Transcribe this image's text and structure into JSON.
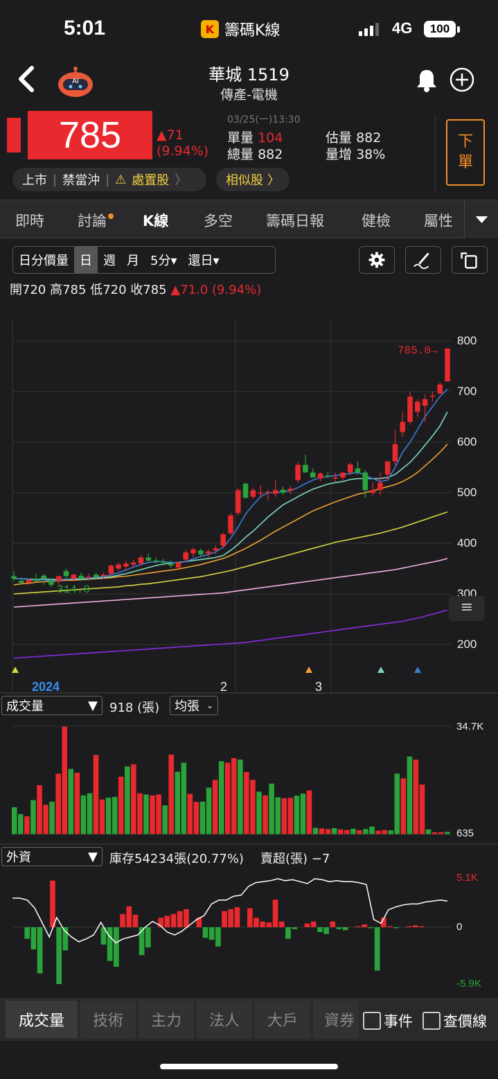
{
  "status_bar": {
    "time": "5:01",
    "app_name": "籌碼K線",
    "network": "4G",
    "battery": "100"
  },
  "header": {
    "stock_name": "華城 1519",
    "category": "傳產-電機"
  },
  "quote": {
    "price": "785",
    "change": "▲71",
    "change_pct": "(9.94%)",
    "datetime": "03/25(一)13:30",
    "unit_volume_label": "單量",
    "unit_volume": "104",
    "total_volume_label": "總量",
    "total_volume": "882",
    "est_volume_label": "估量",
    "est_volume": "882",
    "vol_increase_label": "量增",
    "vol_increase": "38%",
    "sell_button": [
      "下",
      "單"
    ]
  },
  "tags": {
    "market": "上市",
    "day_trade": "禁當沖",
    "disposition": "處置股",
    "similar": "相似股"
  },
  "tabs": [
    {
      "label": "即時"
    },
    {
      "label": "討論"
    },
    {
      "label": "K線"
    },
    {
      "label": "多空"
    },
    {
      "label": "籌碼日報"
    },
    {
      "label": "健檢"
    },
    {
      "label": "屬性"
    }
  ],
  "period": {
    "options": [
      "日分價量",
      "日",
      "週",
      "月",
      "5分▾",
      "還日▾"
    ],
    "selected": "日"
  },
  "ohlc": {
    "open_label": "開",
    "open": "720",
    "high_label": "高",
    "high": "785",
    "low_label": "低",
    "low": "720",
    "close_label": "收",
    "close": "785",
    "change": "▲71.0 (9.94%)"
  },
  "kchart": {
    "y_ticks": [
      "800",
      "700",
      "600",
      "500",
      "400",
      "300",
      "200"
    ],
    "x_labels": [
      "2024",
      "2",
      "3"
    ],
    "last_label": "785.0→",
    "low_label": "314.0",
    "colors": {
      "up": "#e8292e",
      "down": "#2aa33a",
      "ma5": "#3a7bd5",
      "ma10": "#7fd8c0",
      "ma20": "#f0a030",
      "ma60": "#d8d840",
      "ma120": "#f0b0e0",
      "ma240": "#8a2be2"
    }
  },
  "volume_panel": {
    "selector": "成交量",
    "value": "918 (張)",
    "avg_button": "均張",
    "y_max": "34.7K",
    "y_min": "635"
  },
  "foreign_panel": {
    "selector": "外資",
    "inventory": "庫存54234張(20.77%)",
    "net": "賣超(張) −7",
    "y_max": "5.1K",
    "y_zero": "0",
    "y_min": "-5.9K"
  },
  "chart_data": [
    {
      "type": "candlestick",
      "title": "",
      "ylim": [
        200,
        800
      ],
      "candles": [
        {
          "o": 335,
          "h": 345,
          "l": 325,
          "c": 330
        },
        {
          "o": 326,
          "h": 332,
          "l": 320,
          "c": 322
        },
        {
          "o": 322,
          "h": 330,
          "l": 318,
          "c": 328
        },
        {
          "o": 330,
          "h": 340,
          "l": 325,
          "c": 325
        },
        {
          "o": 336,
          "h": 340,
          "l": 318,
          "c": 330
        },
        {
          "o": 326,
          "h": 330,
          "l": 314,
          "c": 318
        },
        {
          "o": 326,
          "h": 335,
          "l": 318,
          "c": 335
        },
        {
          "o": 345,
          "h": 350,
          "l": 330,
          "c": 335
        },
        {
          "o": 330,
          "h": 340,
          "l": 325,
          "c": 338
        },
        {
          "o": 336,
          "h": 342,
          "l": 326,
          "c": 330
        },
        {
          "o": 332,
          "h": 340,
          "l": 326,
          "c": 334
        },
        {
          "o": 338,
          "h": 342,
          "l": 330,
          "c": 333
        },
        {
          "o": 335,
          "h": 342,
          "l": 330,
          "c": 338
        },
        {
          "o": 340,
          "h": 358,
          "l": 336,
          "c": 356
        },
        {
          "o": 350,
          "h": 362,
          "l": 346,
          "c": 358
        },
        {
          "o": 354,
          "h": 366,
          "l": 348,
          "c": 360
        },
        {
          "o": 358,
          "h": 368,
          "l": 352,
          "c": 362
        },
        {
          "o": 360,
          "h": 376,
          "l": 356,
          "c": 372
        },
        {
          "o": 372,
          "h": 380,
          "l": 362,
          "c": 366
        },
        {
          "o": 366,
          "h": 372,
          "l": 360,
          "c": 364
        },
        {
          "o": 364,
          "h": 370,
          "l": 356,
          "c": 362
        },
        {
          "o": 360,
          "h": 366,
          "l": 352,
          "c": 356
        },
        {
          "o": 352,
          "h": 364,
          "l": 348,
          "c": 362
        },
        {
          "o": 368,
          "h": 386,
          "l": 362,
          "c": 382
        },
        {
          "o": 380,
          "h": 392,
          "l": 372,
          "c": 388
        },
        {
          "o": 386,
          "h": 390,
          "l": 374,
          "c": 378
        },
        {
          "o": 380,
          "h": 388,
          "l": 372,
          "c": 384
        },
        {
          "o": 386,
          "h": 396,
          "l": 378,
          "c": 390
        },
        {
          "o": 395,
          "h": 420,
          "l": 390,
          "c": 418
        },
        {
          "o": 420,
          "h": 460,
          "l": 416,
          "c": 455
        },
        {
          "o": 460,
          "h": 510,
          "l": 455,
          "c": 505
        },
        {
          "o": 518,
          "h": 520,
          "l": 488,
          "c": 490
        },
        {
          "o": 492,
          "h": 510,
          "l": 488,
          "c": 505
        },
        {
          "o": 500,
          "h": 515,
          "l": 492,
          "c": 500
        },
        {
          "o": 500,
          "h": 505,
          "l": 485,
          "c": 502
        },
        {
          "o": 498,
          "h": 525,
          "l": 492,
          "c": 505
        },
        {
          "o": 506,
          "h": 512,
          "l": 496,
          "c": 500
        },
        {
          "o": 504,
          "h": 514,
          "l": 498,
          "c": 508
        },
        {
          "o": 525,
          "h": 560,
          "l": 520,
          "c": 555
        },
        {
          "o": 555,
          "h": 575,
          "l": 540,
          "c": 540
        },
        {
          "o": 540,
          "h": 548,
          "l": 530,
          "c": 530
        },
        {
          "o": 528,
          "h": 540,
          "l": 522,
          "c": 538
        },
        {
          "o": 534,
          "h": 542,
          "l": 528,
          "c": 532
        },
        {
          "o": 528,
          "h": 540,
          "l": 522,
          "c": 530
        },
        {
          "o": 530,
          "h": 540,
          "l": 524,
          "c": 540
        },
        {
          "o": 540,
          "h": 560,
          "l": 535,
          "c": 556
        },
        {
          "o": 548,
          "h": 562,
          "l": 536,
          "c": 540
        },
        {
          "o": 540,
          "h": 545,
          "l": 490,
          "c": 505
        },
        {
          "o": 500,
          "h": 520,
          "l": 495,
          "c": 505
        },
        {
          "o": 505,
          "h": 540,
          "l": 495,
          "c": 520
        },
        {
          "o": 536,
          "h": 562,
          "l": 525,
          "c": 562
        },
        {
          "o": 562,
          "h": 624,
          "l": 555,
          "c": 596
        },
        {
          "o": 620,
          "h": 660,
          "l": 610,
          "c": 640
        },
        {
          "o": 640,
          "h": 700,
          "l": 635,
          "c": 690
        },
        {
          "o": 660,
          "h": 685,
          "l": 650,
          "c": 680
        },
        {
          "o": 672,
          "h": 695,
          "l": 640,
          "c": 685
        },
        {
          "o": 690,
          "h": 700,
          "l": 680,
          "c": 692
        },
        {
          "o": 696,
          "h": 718,
          "l": 695,
          "c": 714
        },
        {
          "o": 720,
          "h": 785,
          "l": 720,
          "c": 785
        }
      ],
      "ma5": [
        330,
        330,
        328,
        327,
        328,
        326,
        327,
        329,
        330,
        331,
        331,
        333,
        334,
        338,
        342,
        347,
        353,
        358,
        362,
        364,
        364,
        362,
        361,
        364,
        369,
        374,
        378,
        383,
        392,
        410,
        432,
        458,
        476,
        492,
        500,
        500,
        502,
        504,
        510,
        518,
        525,
        530,
        532,
        534,
        536,
        538,
        540,
        535,
        528,
        522,
        525,
        550,
        580,
        600,
        625,
        650,
        670,
        690,
        705
      ],
      "ma10": [
        330,
        330,
        329,
        329,
        329,
        329,
        328,
        329,
        329,
        329,
        330,
        331,
        332,
        334,
        337,
        340,
        344,
        348,
        352,
        356,
        359,
        361,
        362,
        364,
        366,
        368,
        370,
        372,
        376,
        386,
        398,
        412,
        424,
        438,
        452,
        464,
        476,
        484,
        492,
        500,
        507,
        512,
        517,
        520,
        522,
        526,
        528,
        528,
        528,
        528,
        530,
        536,
        548,
        560,
        576,
        594,
        612,
        632,
        660
      ],
      "ma20": [
        318,
        320,
        321,
        323,
        324,
        325,
        326,
        327,
        327,
        328,
        329,
        330,
        331,
        332,
        334,
        335,
        337,
        339,
        341,
        343,
        345,
        347,
        349,
        352,
        355,
        358,
        362,
        366,
        370,
        376,
        383,
        390,
        398,
        406,
        415,
        424,
        432,
        440,
        448,
        456,
        464,
        470,
        476,
        482,
        487,
        492,
        497,
        500,
        504,
        508,
        512,
        516,
        522,
        530,
        540,
        553,
        566,
        580,
        596
      ],
      "ma60": [
        300,
        301,
        302,
        303,
        304,
        305,
        306,
        307,
        308,
        309,
        310,
        311,
        312,
        313,
        314,
        316,
        317,
        319,
        320,
        322,
        324,
        326,
        328,
        330,
        332,
        334,
        337,
        340,
        343,
        346,
        350,
        354,
        358,
        362,
        366,
        370,
        374,
        378,
        382,
        386,
        390,
        394,
        398,
        402,
        405,
        408,
        411,
        414,
        417,
        420,
        424,
        428,
        432,
        437,
        442,
        447,
        452,
        457,
        462
      ],
      "ma120": [
        274,
        275,
        276,
        277,
        278,
        279,
        280,
        281,
        282,
        283,
        284,
        285,
        286,
        287,
        288,
        289,
        290,
        291,
        292,
        293,
        294,
        295,
        296,
        297,
        298,
        299,
        300,
        301,
        302,
        304,
        306,
        308,
        310,
        312,
        314,
        316,
        318,
        320,
        322,
        324,
        326,
        328,
        330,
        332,
        334,
        336,
        338,
        340,
        342,
        344,
        346,
        348,
        351,
        354,
        357,
        360,
        363,
        366,
        370
      ],
      "ma240": [
        173,
        174,
        175,
        176,
        177,
        178,
        179,
        180,
        181,
        182,
        183,
        184,
        185,
        186,
        187,
        188,
        189,
        190,
        191,
        192,
        193,
        194,
        195,
        196,
        197,
        198,
        199,
        200,
        201,
        202,
        203,
        204,
        206,
        208,
        210,
        212,
        214,
        216,
        218,
        220,
        222,
        224,
        226,
        228,
        230,
        232,
        234,
        236,
        238,
        240,
        242,
        244,
        246,
        249,
        252,
        256,
        260,
        264,
        268
      ]
    },
    {
      "type": "bar",
      "title": "成交量",
      "ylim": [
        635,
        34700
      ],
      "values": [
        8700,
        6500,
        5800,
        11000,
        15800,
        9500,
        10500,
        19500,
        34700,
        21000,
        19800,
        12500,
        13200,
        25500,
        11200,
        11800,
        12000,
        18500,
        21800,
        22500,
        13200,
        12800,
        12500,
        12800,
        9300,
        25600,
        20100,
        23000,
        13000,
        10400,
        10500,
        15000,
        17500,
        23500,
        23000,
        24500,
        24000,
        20000,
        17500,
        13700,
        12500,
        16300,
        11900,
        11600,
        11700,
        12400,
        13100,
        14100,
        2100,
        1900,
        1700,
        2000,
        1600,
        1400,
        1800,
        1300,
        1700,
        2500,
        1200,
        1400,
        1300,
        19500,
        18000,
        25000,
        24000,
        16000,
        1600,
        700,
        700,
        800
      ]
    },
    {
      "type": "bar+line",
      "title": "外資",
      "ylim": [
        -5900,
        5100
      ],
      "values": [
        0,
        0,
        -1200,
        -2300,
        -4800,
        0,
        4900,
        -5900,
        -2400,
        0,
        0,
        0,
        0,
        0,
        -1800,
        -3500,
        -4100,
        1400,
        2200,
        1300,
        -2900,
        -2100,
        0,
        1000,
        1200,
        1400,
        1700,
        1900,
        0,
        1000,
        -1100,
        -1300,
        -2000,
        1700,
        1900,
        2100,
        0,
        2000,
        1000,
        600,
        500,
        2900,
        600,
        -1200,
        -200,
        0,
        400,
        600,
        -500,
        -700,
        600,
        -200,
        -300,
        0,
        100,
        300,
        -100,
        -4500,
        1000,
        100,
        -100,
        0,
        100,
        200,
        100,
        0,
        0,
        0,
        0
      ],
      "inventory_line": [
        3,
        3,
        2.8,
        2,
        0.5,
        -1,
        1,
        -0.3,
        -1,
        -1.5,
        -1.2,
        -0.8,
        0.5,
        -0.8,
        -1.6,
        -1.2,
        -1,
        -0.8,
        0,
        0.6,
        0.2,
        -0.5,
        -0.8,
        -0.4,
        0.2,
        0.8,
        1.2,
        2.4,
        2.8,
        2.8,
        3.2,
        3.3,
        4.2,
        4.6,
        4.7,
        4.8,
        5.0,
        4.8,
        4.9,
        4.7,
        4.5,
        5.0,
        4.9,
        4.7,
        4.8,
        4.7,
        4.7,
        4.6,
        4.4,
        0.8,
        0.4,
        1.8,
        2.1,
        2.3,
        2.4,
        2.4,
        2.6,
        2.7,
        2.8,
        2.7
      ]
    }
  ],
  "bottom_tabs": {
    "items": [
      "成交量",
      "技術",
      "主力",
      "法人",
      "大戶",
      "資券"
    ],
    "selected": "成交量",
    "checkboxes": [
      "事件",
      "查價線"
    ]
  }
}
